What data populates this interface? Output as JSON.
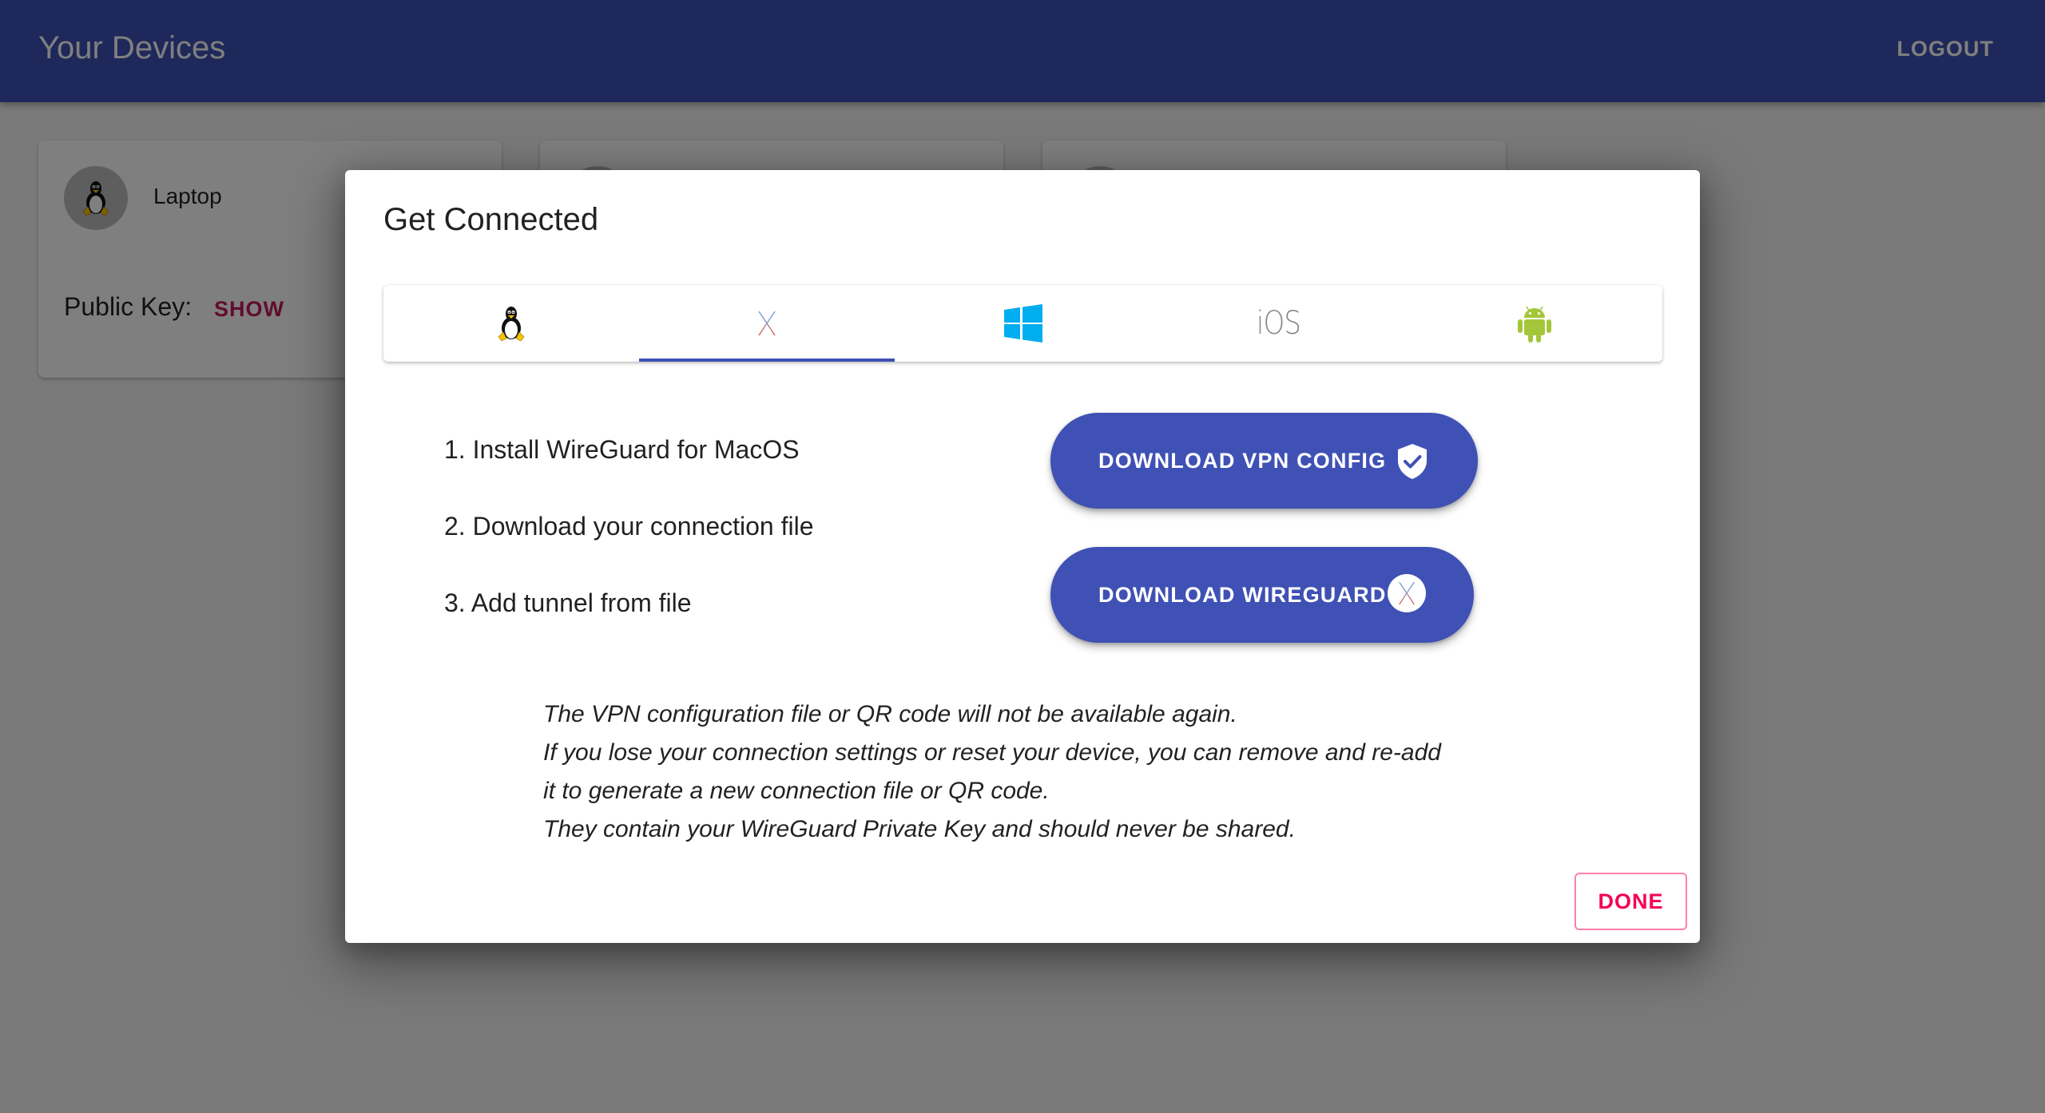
{
  "appbar": {
    "title": "Your Devices",
    "logout_label": "LOGOUT",
    "color": "#3f51b5"
  },
  "devices": [
    {
      "name": "Laptop",
      "os_icon": "linux-tux-icon",
      "public_key_label": "Public Key:",
      "show_label": "SHOW"
    },
    {
      "name": "",
      "os_icon": ""
    },
    {
      "name": "",
      "os_icon": ""
    }
  ],
  "dialog": {
    "title": "Get Connected",
    "tabs": [
      {
        "id": "linux",
        "icon": "linux-tux-icon",
        "active": false
      },
      {
        "id": "macos",
        "icon": "macos-x-icon",
        "active": true
      },
      {
        "id": "windows",
        "icon": "windows-logo-icon",
        "active": false
      },
      {
        "id": "ios",
        "icon": "ios-text-icon",
        "label": "iOS",
        "active": false
      },
      {
        "id": "android",
        "icon": "android-robot-icon",
        "active": false
      }
    ],
    "steps": [
      "1. Install WireGuard for MacOS",
      "2. Download your connection file",
      "3. Add tunnel from file"
    ],
    "buttons": {
      "download_config": {
        "label": "DOWNLOAD VPN CONFIG",
        "icon": "shield-check-icon"
      },
      "download_wireguard": {
        "label": "DOWNLOAD WIREGUARD",
        "icon": "macos-x-icon"
      }
    },
    "note_lines": [
      "The VPN configuration file or QR code will not be available again.",
      "If you lose your connection settings or reset your device, you can remove and re-add",
      "it to generate a new connection file or QR code.",
      "They contain your WireGuard Private Key and should never be shared."
    ],
    "done_label": "DONE"
  },
  "colors": {
    "primary": "#3f51b5",
    "accent": "#f50057",
    "windows": "#00adef",
    "android": "#a4c639"
  }
}
